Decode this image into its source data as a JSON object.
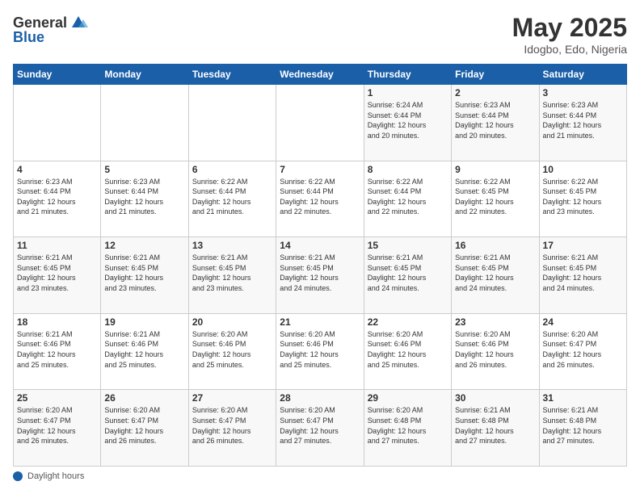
{
  "logo": {
    "general": "General",
    "blue": "Blue"
  },
  "title": "May 2025",
  "location": "Idogbo, Edo, Nigeria",
  "days_header": [
    "Sunday",
    "Monday",
    "Tuesday",
    "Wednesday",
    "Thursday",
    "Friday",
    "Saturday"
  ],
  "footer_label": "Daylight hours",
  "weeks": [
    [
      {
        "num": "",
        "info": ""
      },
      {
        "num": "",
        "info": ""
      },
      {
        "num": "",
        "info": ""
      },
      {
        "num": "",
        "info": ""
      },
      {
        "num": "1",
        "info": "Sunrise: 6:24 AM\nSunset: 6:44 PM\nDaylight: 12 hours\nand 20 minutes."
      },
      {
        "num": "2",
        "info": "Sunrise: 6:23 AM\nSunset: 6:44 PM\nDaylight: 12 hours\nand 20 minutes."
      },
      {
        "num": "3",
        "info": "Sunrise: 6:23 AM\nSunset: 6:44 PM\nDaylight: 12 hours\nand 21 minutes."
      }
    ],
    [
      {
        "num": "4",
        "info": "Sunrise: 6:23 AM\nSunset: 6:44 PM\nDaylight: 12 hours\nand 21 minutes."
      },
      {
        "num": "5",
        "info": "Sunrise: 6:23 AM\nSunset: 6:44 PM\nDaylight: 12 hours\nand 21 minutes."
      },
      {
        "num": "6",
        "info": "Sunrise: 6:22 AM\nSunset: 6:44 PM\nDaylight: 12 hours\nand 21 minutes."
      },
      {
        "num": "7",
        "info": "Sunrise: 6:22 AM\nSunset: 6:44 PM\nDaylight: 12 hours\nand 22 minutes."
      },
      {
        "num": "8",
        "info": "Sunrise: 6:22 AM\nSunset: 6:44 PM\nDaylight: 12 hours\nand 22 minutes."
      },
      {
        "num": "9",
        "info": "Sunrise: 6:22 AM\nSunset: 6:45 PM\nDaylight: 12 hours\nand 22 minutes."
      },
      {
        "num": "10",
        "info": "Sunrise: 6:22 AM\nSunset: 6:45 PM\nDaylight: 12 hours\nand 23 minutes."
      }
    ],
    [
      {
        "num": "11",
        "info": "Sunrise: 6:21 AM\nSunset: 6:45 PM\nDaylight: 12 hours\nand 23 minutes."
      },
      {
        "num": "12",
        "info": "Sunrise: 6:21 AM\nSunset: 6:45 PM\nDaylight: 12 hours\nand 23 minutes."
      },
      {
        "num": "13",
        "info": "Sunrise: 6:21 AM\nSunset: 6:45 PM\nDaylight: 12 hours\nand 23 minutes."
      },
      {
        "num": "14",
        "info": "Sunrise: 6:21 AM\nSunset: 6:45 PM\nDaylight: 12 hours\nand 24 minutes."
      },
      {
        "num": "15",
        "info": "Sunrise: 6:21 AM\nSunset: 6:45 PM\nDaylight: 12 hours\nand 24 minutes."
      },
      {
        "num": "16",
        "info": "Sunrise: 6:21 AM\nSunset: 6:45 PM\nDaylight: 12 hours\nand 24 minutes."
      },
      {
        "num": "17",
        "info": "Sunrise: 6:21 AM\nSunset: 6:45 PM\nDaylight: 12 hours\nand 24 minutes."
      }
    ],
    [
      {
        "num": "18",
        "info": "Sunrise: 6:21 AM\nSunset: 6:46 PM\nDaylight: 12 hours\nand 25 minutes."
      },
      {
        "num": "19",
        "info": "Sunrise: 6:21 AM\nSunset: 6:46 PM\nDaylight: 12 hours\nand 25 minutes."
      },
      {
        "num": "20",
        "info": "Sunrise: 6:20 AM\nSunset: 6:46 PM\nDaylight: 12 hours\nand 25 minutes."
      },
      {
        "num": "21",
        "info": "Sunrise: 6:20 AM\nSunset: 6:46 PM\nDaylight: 12 hours\nand 25 minutes."
      },
      {
        "num": "22",
        "info": "Sunrise: 6:20 AM\nSunset: 6:46 PM\nDaylight: 12 hours\nand 25 minutes."
      },
      {
        "num": "23",
        "info": "Sunrise: 6:20 AM\nSunset: 6:46 PM\nDaylight: 12 hours\nand 26 minutes."
      },
      {
        "num": "24",
        "info": "Sunrise: 6:20 AM\nSunset: 6:47 PM\nDaylight: 12 hours\nand 26 minutes."
      }
    ],
    [
      {
        "num": "25",
        "info": "Sunrise: 6:20 AM\nSunset: 6:47 PM\nDaylight: 12 hours\nand 26 minutes."
      },
      {
        "num": "26",
        "info": "Sunrise: 6:20 AM\nSunset: 6:47 PM\nDaylight: 12 hours\nand 26 minutes."
      },
      {
        "num": "27",
        "info": "Sunrise: 6:20 AM\nSunset: 6:47 PM\nDaylight: 12 hours\nand 26 minutes."
      },
      {
        "num": "28",
        "info": "Sunrise: 6:20 AM\nSunset: 6:47 PM\nDaylight: 12 hours\nand 27 minutes."
      },
      {
        "num": "29",
        "info": "Sunrise: 6:20 AM\nSunset: 6:48 PM\nDaylight: 12 hours\nand 27 minutes."
      },
      {
        "num": "30",
        "info": "Sunrise: 6:21 AM\nSunset: 6:48 PM\nDaylight: 12 hours\nand 27 minutes."
      },
      {
        "num": "31",
        "info": "Sunrise: 6:21 AM\nSunset: 6:48 PM\nDaylight: 12 hours\nand 27 minutes."
      }
    ]
  ]
}
